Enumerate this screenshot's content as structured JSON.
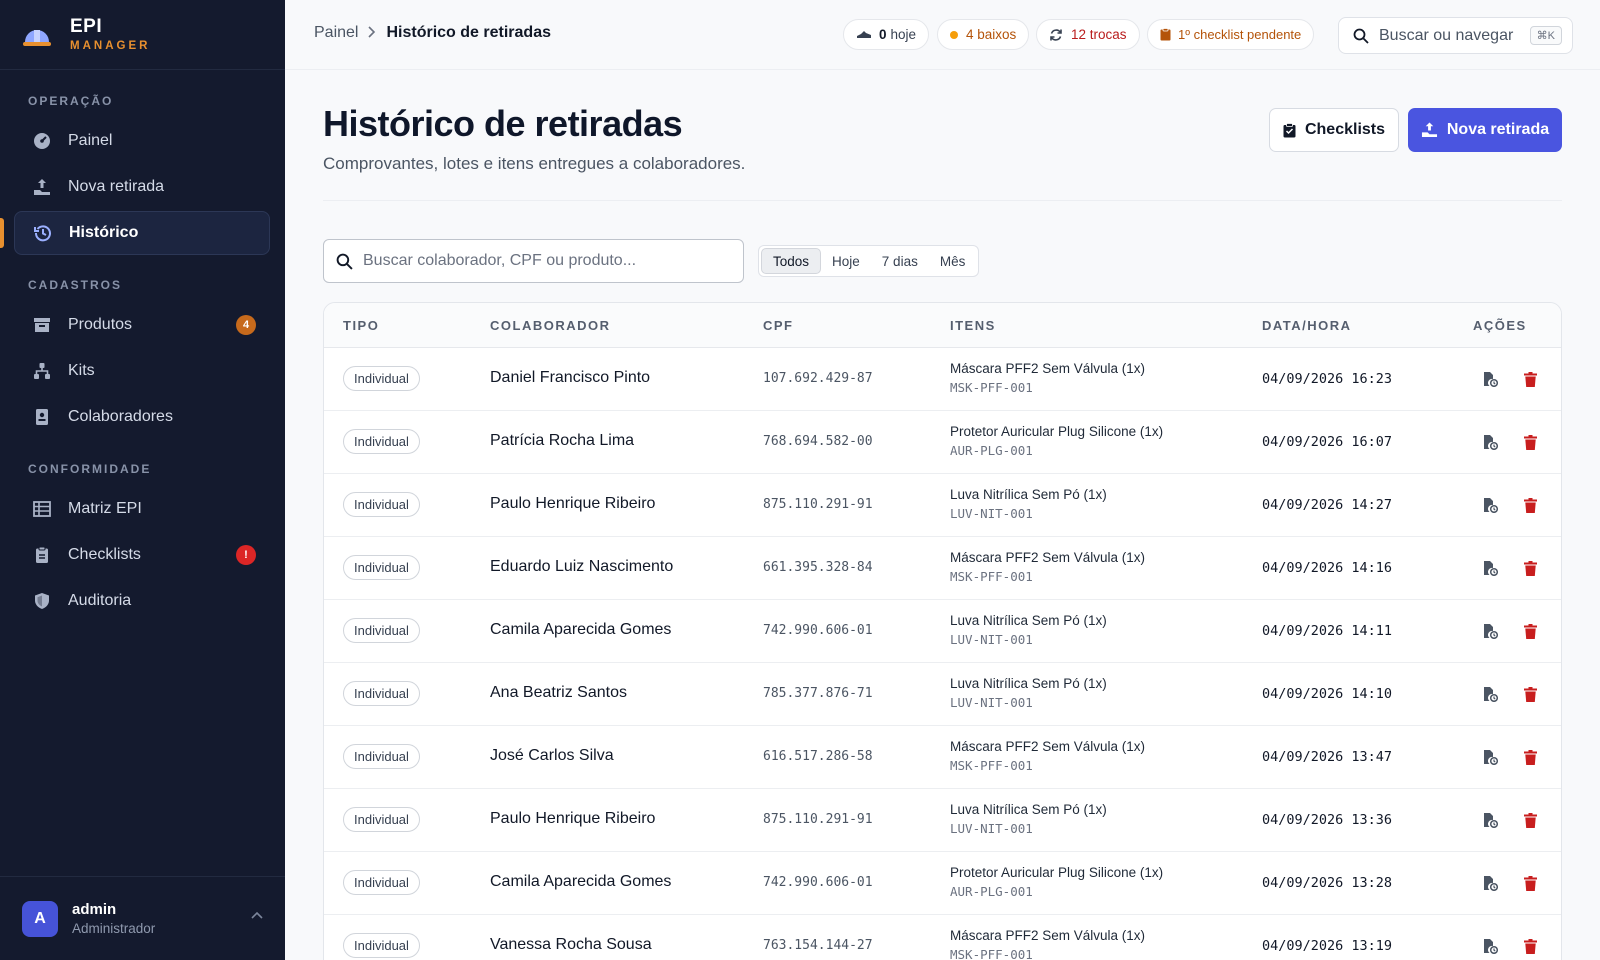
{
  "brand": {
    "name": "EPI",
    "sub": "MANAGER"
  },
  "sidebar": {
    "sections": [
      {
        "title": "OPERAÇÃO"
      },
      {
        "title": "CADASTROS"
      },
      {
        "title": "CONFORMIDADE"
      }
    ],
    "items": [
      {
        "label": "Painel",
        "icon": "dashboard-icon"
      },
      {
        "label": "Nova retirada",
        "icon": "hand-upload-icon"
      },
      {
        "label": "Histórico",
        "icon": "history-icon",
        "active": true
      },
      {
        "label": "Produtos",
        "icon": "archive-icon",
        "badge": "4"
      },
      {
        "label": "Kits",
        "icon": "sitemap-icon"
      },
      {
        "label": "Colaboradores",
        "icon": "id-badge-icon"
      },
      {
        "label": "Matriz EPI",
        "icon": "table-icon"
      },
      {
        "label": "Checklists",
        "icon": "clipboard-icon",
        "badge": "!"
      },
      {
        "label": "Auditoria",
        "icon": "shield-icon"
      }
    ]
  },
  "user": {
    "initial": "A",
    "name": "admin",
    "role": "Administrador"
  },
  "topbar": {
    "breadcrumb": {
      "root": "Painel",
      "current": "Histórico de retiradas"
    },
    "pills": {
      "today": {
        "count": "0",
        "label": "hoje"
      },
      "low": {
        "label": "4 baixos",
        "color": "#f59e0b"
      },
      "swaps": {
        "label": "12 trocas",
        "color": "#b91c1c"
      },
      "checklist": {
        "label": "1º checklist pendente",
        "color": "#b45309"
      }
    },
    "search_placeholder": "Buscar ou navegar",
    "shortcut": "⌘K"
  },
  "header": {
    "title": "Histórico de retiradas",
    "subtitle": "Comprovantes, lotes e itens entregues a colaboradores.",
    "checklists_label": "Checklists",
    "new_label": "Nova retirada",
    "accent": "#4a55e0"
  },
  "filters": {
    "search_placeholder": "Buscar colaborador, CPF ou produto...",
    "ranges": [
      "Todos",
      "Hoje",
      "7 dias",
      "Mês"
    ],
    "selected": "Todos"
  },
  "table": {
    "columns": [
      "TIPO",
      "COLABORADOR",
      "CPF",
      "ITENS",
      "DATA/HORA",
      "AÇÕES"
    ],
    "rows": [
      {
        "tipo": "Individual",
        "nome": "Daniel Francisco Pinto",
        "cpf": "107.692.429-87",
        "item": "Máscara PFF2 Sem Válvula (1x)",
        "sku": "MSK-PFF-001",
        "data": "04/09/2026 16:23"
      },
      {
        "tipo": "Individual",
        "nome": "Patrícia Rocha Lima",
        "cpf": "768.694.582-00",
        "item": "Protetor Auricular Plug Silicone (1x)",
        "sku": "AUR-PLG-001",
        "data": "04/09/2026 16:07"
      },
      {
        "tipo": "Individual",
        "nome": "Paulo Henrique Ribeiro",
        "cpf": "875.110.291-91",
        "item": "Luva Nitrílica Sem Pó (1x)",
        "sku": "LUV-NIT-001",
        "data": "04/09/2026 14:27"
      },
      {
        "tipo": "Individual",
        "nome": "Eduardo Luiz Nascimento",
        "cpf": "661.395.328-84",
        "item": "Máscara PFF2 Sem Válvula (1x)",
        "sku": "MSK-PFF-001",
        "data": "04/09/2026 14:16"
      },
      {
        "tipo": "Individual",
        "nome": "Camila Aparecida Gomes",
        "cpf": "742.990.606-01",
        "item": "Luva Nitrílica Sem Pó (1x)",
        "sku": "LUV-NIT-001",
        "data": "04/09/2026 14:11"
      },
      {
        "tipo": "Individual",
        "nome": "Ana Beatriz Santos",
        "cpf": "785.377.876-71",
        "item": "Luva Nitrílica Sem Pó (1x)",
        "sku": "LUV-NIT-001",
        "data": "04/09/2026 14:10"
      },
      {
        "tipo": "Individual",
        "nome": "José Carlos Silva",
        "cpf": "616.517.286-58",
        "item": "Máscara PFF2 Sem Válvula (1x)",
        "sku": "MSK-PFF-001",
        "data": "04/09/2026 13:47"
      },
      {
        "tipo": "Individual",
        "nome": "Paulo Henrique Ribeiro",
        "cpf": "875.110.291-91",
        "item": "Luva Nitrílica Sem Pó (1x)",
        "sku": "LUV-NIT-001",
        "data": "04/09/2026 13:36"
      },
      {
        "tipo": "Individual",
        "nome": "Camila Aparecida Gomes",
        "cpf": "742.990.606-01",
        "item": "Protetor Auricular Plug Silicone (1x)",
        "sku": "AUR-PLG-001",
        "data": "04/09/2026 13:28"
      },
      {
        "tipo": "Individual",
        "nome": "Vanessa Rocha Sousa",
        "cpf": "763.154.144-27",
        "item": "Máscara PFF2 Sem Válvula (1x)",
        "sku": "MSK-PFF-001",
        "data": "04/09/2026 13:19"
      }
    ]
  }
}
